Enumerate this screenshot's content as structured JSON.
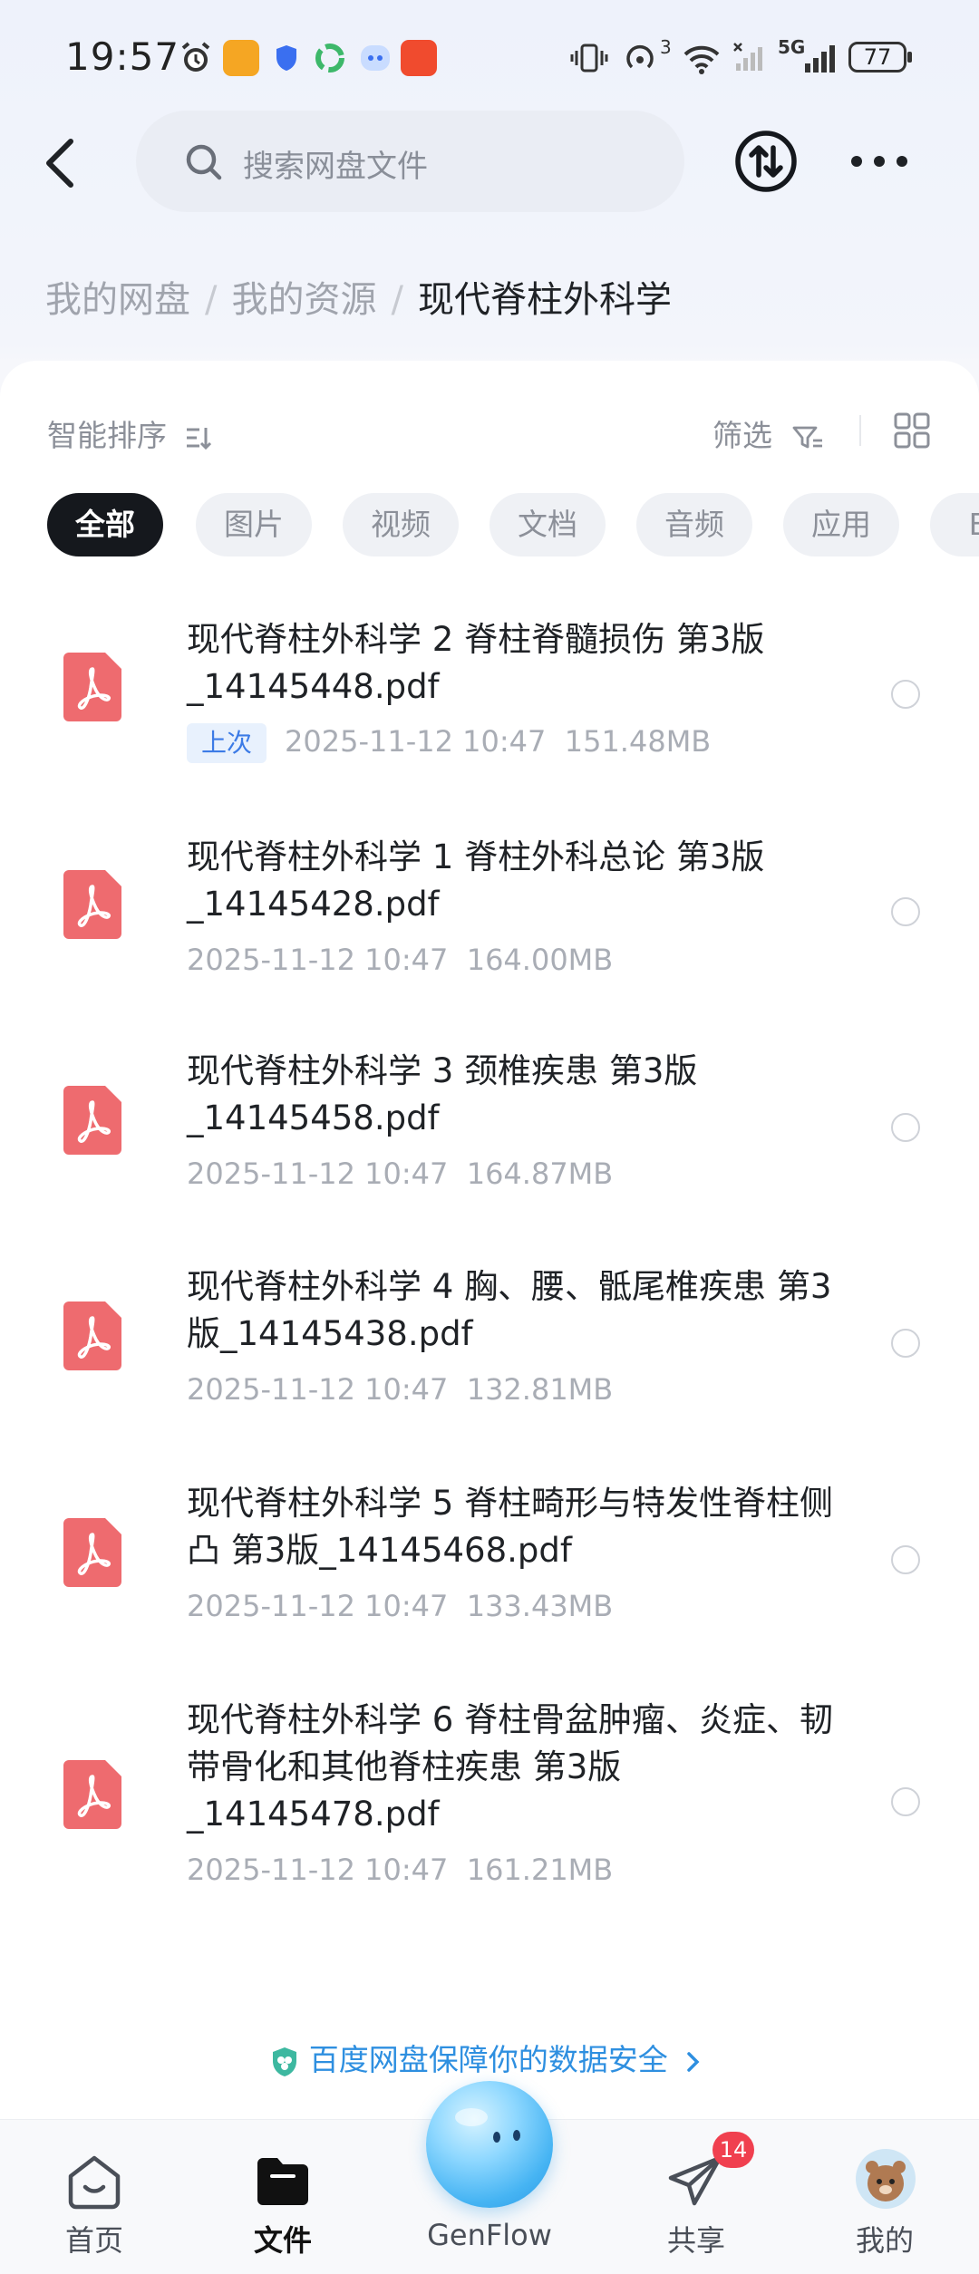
{
  "status_bar": {
    "time": "19:57",
    "battery": "77",
    "network_5g": "5G",
    "hotspot_count": "3"
  },
  "search": {
    "placeholder": "搜索网盘文件"
  },
  "breadcrumb": {
    "items": [
      "我的网盘",
      "我的资源"
    ],
    "separator": "/",
    "current": "现代脊柱外科学"
  },
  "toolbar": {
    "sort_label": "智能排序",
    "filter_label": "筛选"
  },
  "chips": [
    "全部",
    "图片",
    "视频",
    "文档",
    "音频",
    "应用",
    "BT"
  ],
  "files": [
    {
      "name": "现代脊柱外科学 2 脊柱脊髓损伤 第3版_14145448.pdf",
      "tag": "上次",
      "date": "2025-11-12  10:47",
      "size": "151.48MB"
    },
    {
      "name": "现代脊柱外科学 1 脊柱外科总论 第3版_14145428.pdf",
      "date": "2025-11-12  10:47",
      "size": "164.00MB"
    },
    {
      "name": "现代脊柱外科学 3 颈椎疾患 第3版_14145458.pdf",
      "date": "2025-11-12  10:47",
      "size": "164.87MB"
    },
    {
      "name": "现代脊柱外科学 4 胸、腰、骶尾椎疾患 第3版_14145438.pdf",
      "date": "2025-11-12  10:47",
      "size": "132.81MB"
    },
    {
      "name": "现代脊柱外科学 5 脊柱畸形与特发性脊柱侧凸 第3版_14145468.pdf",
      "date": "2025-11-12  10:47",
      "size": "133.43MB"
    },
    {
      "name": "现代脊柱外科学 6 脊柱骨盆肿瘤、炎症、韧带骨化和其他脊柱疾患 第3版_14145478.pdf",
      "date": "2025-11-12  10:47",
      "size": "161.21MB"
    }
  ],
  "safety_banner": "百度网盘保障你的数据安全",
  "bottom_nav": {
    "home": "首页",
    "files": "文件",
    "genflow": "GenFlow",
    "share": "共享",
    "share_badge": "14",
    "me": "我的"
  },
  "colors": {
    "pdf_icon": "#ee6b6f",
    "accent_blue": "#2e8fe0",
    "active_chip": "#15181d",
    "badge": "#f0404f"
  }
}
